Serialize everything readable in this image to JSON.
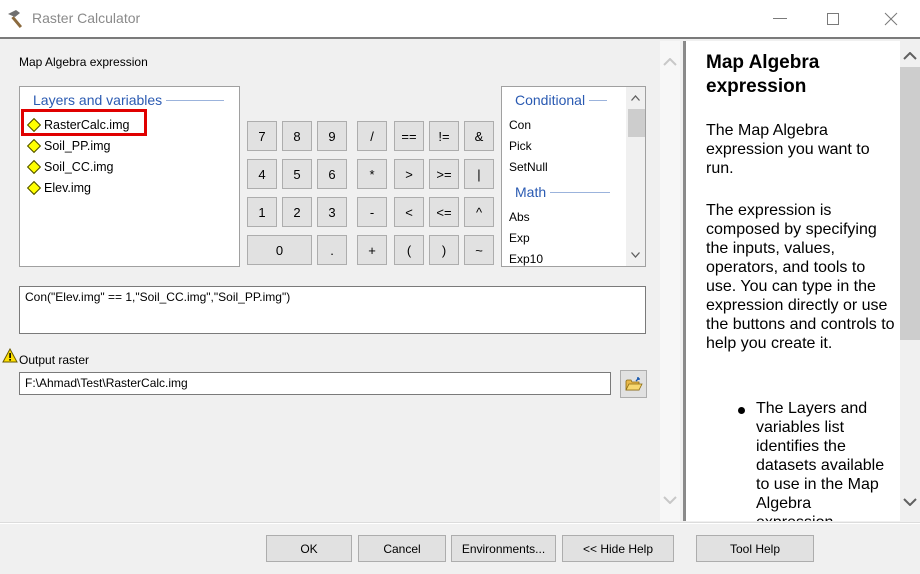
{
  "window": {
    "title": "Raster Calculator",
    "icon": "hammer-icon",
    "controls": {
      "minimize": "—",
      "maximize": "☐",
      "close": "✕"
    }
  },
  "expression_section": {
    "label": "Map Algebra expression",
    "layers": {
      "header": "Layers and variables",
      "items": [
        {
          "label": "RasterCalc.img",
          "highlighted": true
        },
        {
          "label": "Soil_PP.img",
          "highlighted": false
        },
        {
          "label": "Soil_CC.img",
          "highlighted": false
        },
        {
          "label": "Elev.img",
          "highlighted": false
        }
      ],
      "highlight_color": "#e00000"
    },
    "keypad": {
      "rows": [
        [
          "7",
          "8",
          "9",
          "/",
          "==",
          "!=",
          "&"
        ],
        [
          "4",
          "5",
          "6",
          "*",
          ">",
          ">=",
          "|"
        ],
        [
          "1",
          "2",
          "3",
          "-",
          "<",
          "<=",
          "^"
        ],
        [
          "0",
          ".",
          "+",
          "(",
          ")",
          "~"
        ]
      ]
    },
    "functions": {
      "groups": [
        {
          "header": "Conditional",
          "items": [
            "Con",
            "Pick",
            "SetNull"
          ]
        },
        {
          "header": "Math",
          "items": [
            "Abs",
            "Exp",
            "Exp10"
          ]
        }
      ]
    },
    "expression_value": "Con(\"Elev.img\" == 1,\"Soil_CC.img\",\"Soil_PP.img\")"
  },
  "output": {
    "label": "Output raster",
    "warning_icon": "warning-icon",
    "value": "F:\\Ahmad\\Test\\RasterCalc.img",
    "browse_icon": "folder-open-icon"
  },
  "help": {
    "title": "Map Algebra expression",
    "paragraphs": [
      "The Map Algebra expression you want to run.",
      "The expression is composed by specifying the inputs, values, operators, and tools to use. You can type in the expression directly or use the buttons and controls to help you create it."
    ],
    "bullets": [
      "The Layers and variables list identifies the datasets available to use in the Map Algebra expression."
    ]
  },
  "footer": {
    "ok": "OK",
    "cancel": "Cancel",
    "environments": "Environments...",
    "hide_help": "<< Hide Help",
    "tool_help": "Tool Help"
  }
}
